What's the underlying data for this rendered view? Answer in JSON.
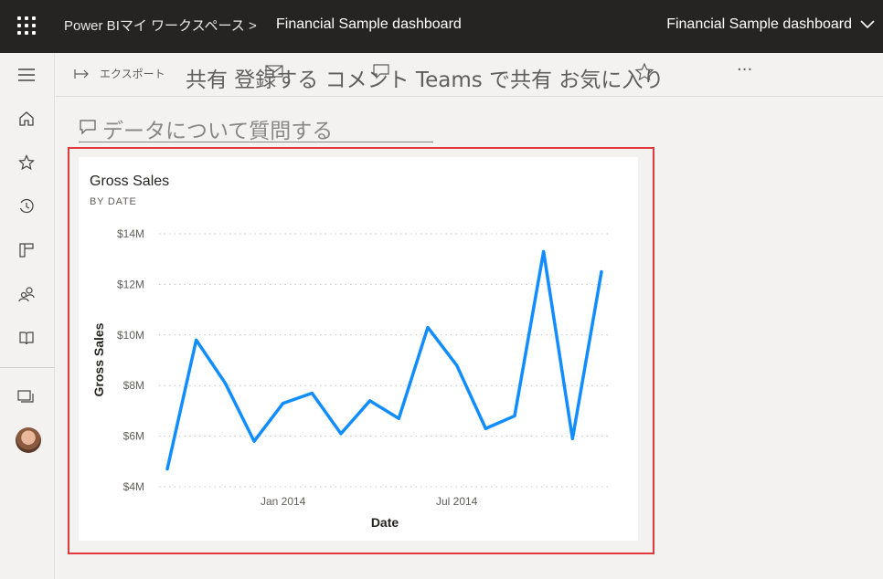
{
  "topbar": {
    "breadcrumb": "Power BIマイ ワークスペース >",
    "report_title": "Financial Sample dashboard",
    "dashboard_selector": "Financial Sample dashboard"
  },
  "actionbar": {
    "export_label": "エクスポート",
    "actions_text": "共有 登録する コメント Teams で共有 お気に入り",
    "more": "···"
  },
  "qna": {
    "placeholder": "データについて質問する"
  },
  "tile": {
    "title": "Gross Sales",
    "subtitle": "BY DATE"
  },
  "colors": {
    "line": "#118dff",
    "highlight": "#e0383b"
  },
  "chart_data": {
    "type": "line",
    "title": "Gross Sales",
    "subtitle": "BY DATE",
    "xlabel": "Date",
    "ylabel": "Gross Sales",
    "ylim": [
      4,
      14
    ],
    "yticks": [
      "$4M",
      "$6M",
      "$8M",
      "$10M",
      "$12M",
      "$14M"
    ],
    "xticks": [
      "Jan 2014",
      "Jul 2014"
    ],
    "x": [
      "2013-09",
      "2013-10",
      "2013-11",
      "2013-12",
      "2014-01",
      "2014-02",
      "2014-03",
      "2014-04",
      "2014-05",
      "2014-06",
      "2014-07",
      "2014-08",
      "2014-09",
      "2014-10",
      "2014-11",
      "2014-12"
    ],
    "values": [
      4.7,
      9.8,
      8.1,
      5.8,
      7.3,
      7.7,
      6.1,
      7.4,
      6.7,
      10.3,
      8.8,
      6.3,
      6.8,
      13.3,
      5.9,
      12.5
    ],
    "grid": true
  }
}
